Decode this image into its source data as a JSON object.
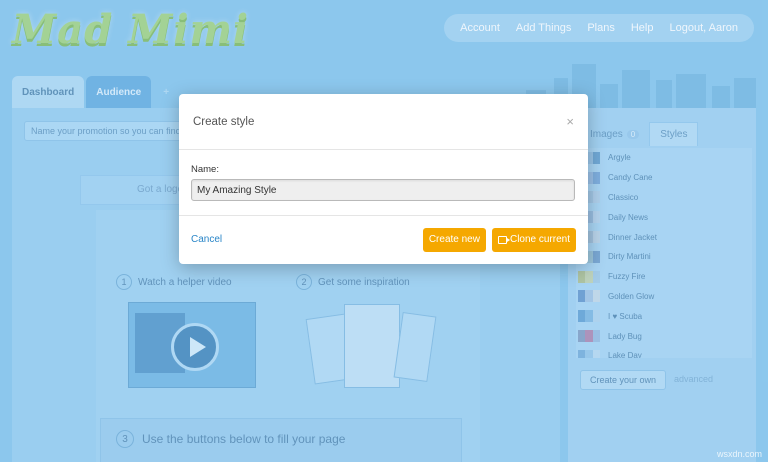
{
  "app": {
    "logo_text": "Mad Mimi",
    "nav": [
      "Account",
      "Add Things",
      "Plans",
      "Help",
      "Logout, Aaron"
    ],
    "tabs": {
      "dashboard": "Dashboard",
      "audience": "Audience",
      "plus": "+"
    }
  },
  "editor": {
    "promo_placeholder": "Name your promotion so you can find it later",
    "logo_prompt": "Got a logo?",
    "step1": {
      "num": "1",
      "label": "Watch a helper video"
    },
    "step2": {
      "num": "2",
      "label": "Get some inspiration"
    },
    "step3": {
      "num": "3",
      "label": "Use the buttons below to fill your page"
    }
  },
  "sidebar": {
    "tab_images": "Images",
    "images_count": "0",
    "tab_styles": "Styles",
    "styles": [
      {
        "name": "Argyle",
        "colors": [
          "#7fb4db",
          "#9cc6e8",
          "#6fa7d3"
        ]
      },
      {
        "name": "Candy Cane",
        "colors": [
          "#c6d4ea",
          "#9ec1e6",
          "#7faedd"
        ]
      },
      {
        "name": "Classico",
        "colors": [
          "#8fb7d8",
          "#a6c8e4",
          "#b5d3ec"
        ]
      },
      {
        "name": "Daily News",
        "colors": [
          "#6f9fca",
          "#9dbfe0",
          "#bcd8ef"
        ]
      },
      {
        "name": "Dinner Jacket",
        "colors": [
          "#8aa9c6",
          "#a6c3dc",
          "#c1d8ea"
        ]
      },
      {
        "name": "Dirty Martini",
        "colors": [
          "#8fb8a9",
          "#9fc7d9",
          "#7aa7d2"
        ]
      },
      {
        "name": "Fuzzy Fire",
        "colors": [
          "#b5c79a",
          "#c7d6b7",
          "#a9cfe9"
        ]
      },
      {
        "name": "Golden Glow",
        "colors": [
          "#6f9fd1",
          "#a8c8e6",
          "#c9dcea"
        ]
      },
      {
        "name": "I ♥ Scuba",
        "colors": [
          "#6da8d8",
          "#87bce4",
          "#b4d6ef"
        ]
      },
      {
        "name": "Lady Bug",
        "colors": [
          "#8aa4c8",
          "#b48fb5",
          "#9fc1e3"
        ]
      },
      {
        "name": "Lake Day",
        "colors": [
          "#7fb3dd",
          "#9ccaeb",
          "#bddcf2"
        ]
      }
    ],
    "create_own": "Create your own",
    "advanced": "advanced"
  },
  "modal": {
    "title": "Create style",
    "close": "×",
    "name_label": "Name:",
    "name_value": "My Amazing Style",
    "cancel": "Cancel",
    "create_new": "Create new",
    "clone_current": "Clone current"
  },
  "watermark": "wsxdn.com"
}
